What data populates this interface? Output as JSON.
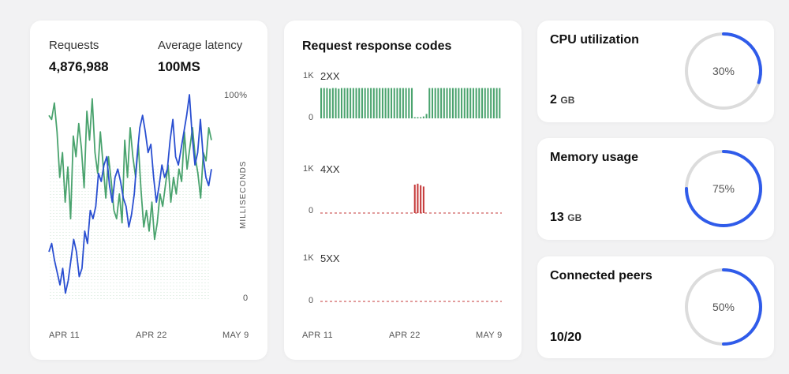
{
  "left_card": {
    "requests_label": "Requests",
    "requests_value": "4,876,988",
    "latency_label": "Average latency",
    "latency_value": "100MS",
    "y_top_label": "100%",
    "y_bottom_label": "0",
    "y_axis_title": "MILLISECONDS",
    "x_labels": [
      "APR 11",
      "APR 22",
      "MAY 9"
    ]
  },
  "middle_card": {
    "title": "Request response codes",
    "x_labels": [
      "APR 11",
      "APR 22",
      "MAY 9"
    ],
    "charts": [
      {
        "code": "2XX",
        "top_label": "1K",
        "bottom_label": "0"
      },
      {
        "code": "4XX",
        "top_label": "1K",
        "bottom_label": "0"
      },
      {
        "code": "5XX",
        "top_label": "1K",
        "bottom_label": "0"
      }
    ]
  },
  "gauges": [
    {
      "title": "CPU utilization",
      "value": "2",
      "unit": "GB",
      "percent_label": "30%",
      "percent": 0.3
    },
    {
      "title": "Memory usage",
      "value": "13",
      "unit": "GB",
      "percent_label": "75%",
      "percent": 0.75
    },
    {
      "title": "Connected peers",
      "value": "10/20",
      "unit": "",
      "percent_label": "50%",
      "percent": 0.5
    }
  ],
  "colors": {
    "green": "#4aa36e",
    "blue": "#2a4fd1",
    "red": "#c53a3a",
    "gauge_track": "#dcdcdc",
    "gauge_fill": "#2f5bea"
  },
  "chart_data": [
    {
      "type": "line",
      "xlabel": "",
      "ylabel": "MILLISECONDS",
      "x_ticks": [
        "APR 11",
        "APR 22",
        "MAY 9"
      ],
      "ylim": [
        0,
        100
      ],
      "series": [
        {
          "name": "",
          "color": "green",
          "values": [
            90,
            88,
            96,
            82,
            60,
            72,
            48,
            65,
            40,
            80,
            70,
            86,
            74,
            55,
            92,
            78,
            98,
            72,
            62,
            82,
            66,
            50,
            70,
            58,
            44,
            40,
            52,
            38,
            78,
            60,
            84,
            70,
            60,
            76,
            54,
            36,
            44,
            34,
            48,
            30,
            38,
            52,
            46,
            56,
            66,
            48,
            60,
            52,
            64,
            58,
            82,
            64,
            74,
            84,
            70,
            62,
            50,
            72,
            68,
            84,
            78
          ]
        },
        {
          "name": "",
          "color": "blue",
          "values": [
            24,
            28,
            20,
            14,
            8,
            16,
            4,
            10,
            20,
            30,
            24,
            12,
            16,
            34,
            28,
            44,
            40,
            46,
            62,
            58,
            66,
            70,
            56,
            48,
            60,
            64,
            58,
            50,
            46,
            36,
            42,
            52,
            70,
            84,
            90,
            82,
            72,
            76,
            60,
            48,
            56,
            66,
            60,
            64,
            78,
            88,
            70,
            66,
            74,
            82,
            90,
            100,
            80,
            66,
            72,
            88,
            70,
            60,
            56,
            64
          ]
        }
      ]
    },
    {
      "type": "bar",
      "title": "Request response codes",
      "series": [
        {
          "name": "2XX",
          "ylim": [
            0,
            1000
          ],
          "values": [
            960,
            960,
            960,
            940,
            960,
            960,
            940,
            960,
            960,
            960,
            960,
            960,
            960,
            960,
            960,
            960,
            960,
            960,
            960,
            960,
            960,
            960,
            960,
            960,
            960,
            960,
            960,
            960,
            960,
            960,
            960,
            960,
            0,
            0,
            0,
            60,
            140,
            960,
            960,
            960,
            960,
            960,
            960,
            960,
            960,
            960,
            960,
            960,
            960,
            960,
            960,
            960,
            960,
            960,
            960,
            960,
            960,
            960,
            960,
            960,
            960,
            960
          ]
        },
        {
          "name": "4XX",
          "ylim": [
            0,
            1000
          ],
          "values": [
            0,
            0,
            0,
            0,
            0,
            0,
            0,
            0,
            0,
            0,
            0,
            0,
            0,
            0,
            0,
            0,
            0,
            0,
            0,
            0,
            0,
            0,
            0,
            0,
            0,
            0,
            0,
            0,
            0,
            0,
            0,
            0,
            900,
            930,
            880,
            840,
            0,
            0,
            0,
            0,
            0,
            0,
            0,
            0,
            0,
            0,
            0,
            0,
            0,
            0,
            0,
            0,
            0,
            0,
            0,
            0,
            0,
            0,
            0,
            0,
            0,
            0
          ]
        },
        {
          "name": "5XX",
          "ylim": [
            0,
            1000
          ],
          "values": [
            0,
            0,
            0,
            0,
            0,
            0,
            0,
            0,
            0,
            0,
            0,
            0,
            0,
            0,
            0,
            0,
            0,
            0,
            0,
            0,
            0,
            0,
            0,
            0,
            0,
            0,
            0,
            0,
            0,
            0,
            0,
            0,
            0,
            0,
            0,
            0,
            0,
            0,
            0,
            0,
            0,
            0,
            0,
            0,
            0,
            0,
            0,
            0,
            0,
            0,
            0,
            0,
            0,
            0,
            0,
            0,
            0,
            0,
            0,
            0,
            0,
            0
          ]
        }
      ]
    }
  ]
}
